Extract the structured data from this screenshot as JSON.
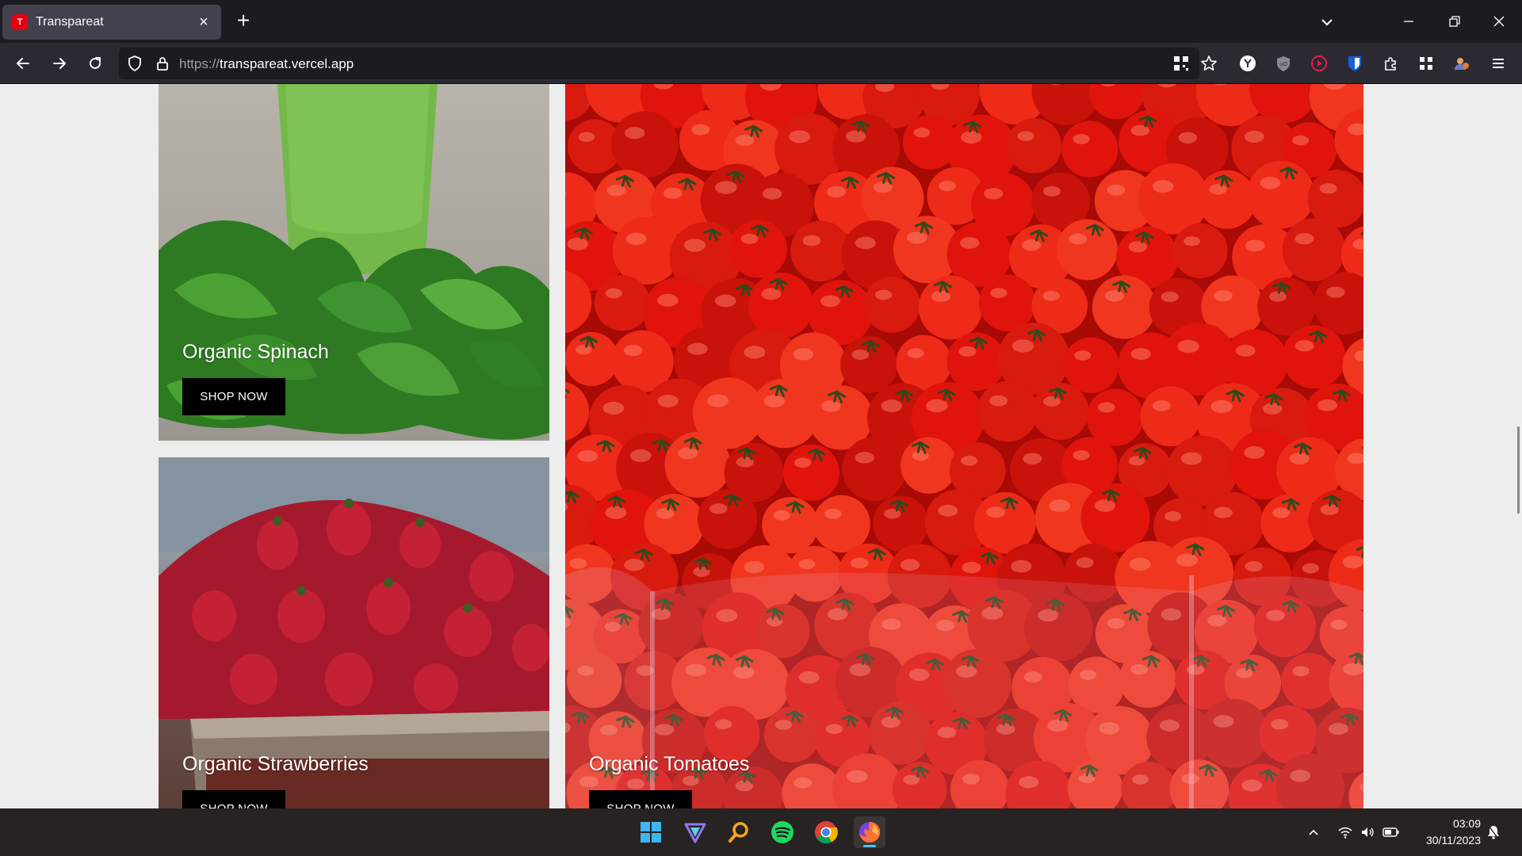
{
  "browser": {
    "tab": {
      "title": "Transpareat",
      "favicon_letter": "T"
    },
    "url": {
      "scheme": "https://",
      "host": "transpareat.vercel.app"
    }
  },
  "page": {
    "cards": [
      {
        "caption": "Organic Spinach",
        "button": "SHOP NOW"
      },
      {
        "caption": "Organic Strawberries",
        "button": "SHOP NOW"
      },
      {
        "caption": "Organic Tomatoes",
        "button": "SHOP NOW"
      }
    ]
  },
  "taskbar": {
    "apps": [
      "windows-start",
      "vpn-app",
      "search-app",
      "spotify",
      "chrome",
      "firefox"
    ],
    "clock": {
      "time": "03:09",
      "date": "30/11/2023"
    }
  },
  "colors": {
    "accent": "#4cc2ff",
    "tomato_red": "#d81a0f",
    "page_bg": "#ededed"
  }
}
